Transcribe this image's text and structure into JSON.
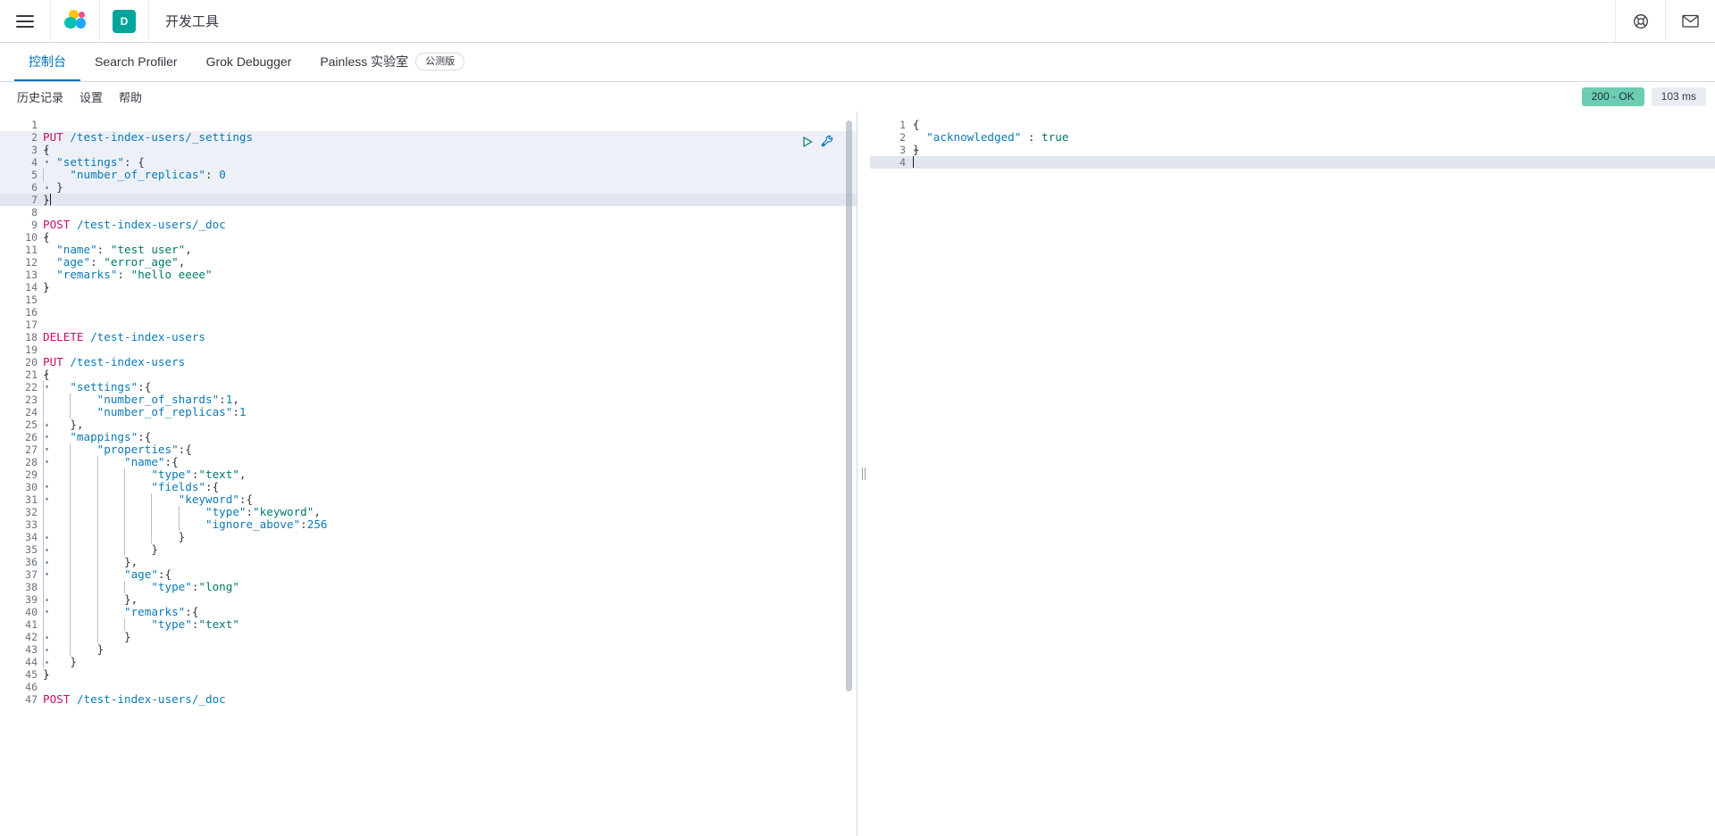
{
  "header": {
    "menu_label": "menu",
    "space_initial": "D",
    "app_title": "开发工具",
    "help_icon": "help-lifebuoy-icon",
    "mail_icon": "mail-icon"
  },
  "tabs": [
    {
      "label": "控制台",
      "active": true,
      "badge": null
    },
    {
      "label": "Search Profiler",
      "active": false,
      "badge": null
    },
    {
      "label": "Grok Debugger",
      "active": false,
      "badge": null
    },
    {
      "label": "Painless 实验室",
      "active": false,
      "badge": "公测版"
    }
  ],
  "subnav": {
    "items": [
      {
        "label": "历史记录"
      },
      {
        "label": "设置"
      },
      {
        "label": "帮助"
      }
    ],
    "status": "200 - OK",
    "duration": "103 ms",
    "status_color": "#6dccb1",
    "duration_bg": "#e9edf3"
  },
  "editor": {
    "play_icon": "play-request-icon",
    "wrench_icon": "wrench-open-docs-icon",
    "lines": [
      {
        "n": 1,
        "fold": "",
        "hl": false,
        "active": false,
        "text": ""
      },
      {
        "n": 2,
        "fold": "",
        "hl": true,
        "active": false,
        "text": "PUT /test-index-users/_settings"
      },
      {
        "n": 3,
        "fold": "▾",
        "hl": true,
        "active": false,
        "text": "{"
      },
      {
        "n": 4,
        "fold": "▾",
        "hl": true,
        "active": false,
        "text": "  \"settings\": {"
      },
      {
        "n": 5,
        "fold": "",
        "hl": true,
        "active": false,
        "text": "    \"number_of_replicas\": 0"
      },
      {
        "n": 6,
        "fold": "▴",
        "hl": true,
        "active": false,
        "text": "  }"
      },
      {
        "n": 7,
        "fold": "▴",
        "hl": true,
        "active": true,
        "text": "}"
      },
      {
        "n": 8,
        "fold": "",
        "hl": false,
        "active": false,
        "text": ""
      },
      {
        "n": 9,
        "fold": "",
        "hl": false,
        "active": false,
        "text": "POST /test-index-users/_doc"
      },
      {
        "n": 10,
        "fold": "▾",
        "hl": false,
        "active": false,
        "text": "{"
      },
      {
        "n": 11,
        "fold": "",
        "hl": false,
        "active": false,
        "text": "  \"name\": \"test user\","
      },
      {
        "n": 12,
        "fold": "",
        "hl": false,
        "active": false,
        "text": "  \"age\": \"error_age\","
      },
      {
        "n": 13,
        "fold": "",
        "hl": false,
        "active": false,
        "text": "  \"remarks\": \"hello eeee\""
      },
      {
        "n": 14,
        "fold": "▴",
        "hl": false,
        "active": false,
        "text": "}"
      },
      {
        "n": 15,
        "fold": "",
        "hl": false,
        "active": false,
        "text": ""
      },
      {
        "n": 16,
        "fold": "",
        "hl": false,
        "active": false,
        "text": ""
      },
      {
        "n": 17,
        "fold": "",
        "hl": false,
        "active": false,
        "text": ""
      },
      {
        "n": 18,
        "fold": "",
        "hl": false,
        "active": false,
        "text": "DELETE /test-index-users"
      },
      {
        "n": 19,
        "fold": "",
        "hl": false,
        "active": false,
        "text": ""
      },
      {
        "n": 20,
        "fold": "",
        "hl": false,
        "active": false,
        "text": "PUT /test-index-users"
      },
      {
        "n": 21,
        "fold": "▾",
        "hl": false,
        "active": false,
        "text": "{"
      },
      {
        "n": 22,
        "fold": "▾",
        "hl": false,
        "active": false,
        "text": "    \"settings\":{"
      },
      {
        "n": 23,
        "fold": "",
        "hl": false,
        "active": false,
        "text": "        \"number_of_shards\":1,"
      },
      {
        "n": 24,
        "fold": "",
        "hl": false,
        "active": false,
        "text": "        \"number_of_replicas\":1"
      },
      {
        "n": 25,
        "fold": "▴",
        "hl": false,
        "active": false,
        "text": "    },"
      },
      {
        "n": 26,
        "fold": "▾",
        "hl": false,
        "active": false,
        "text": "    \"mappings\":{"
      },
      {
        "n": 27,
        "fold": "▾",
        "hl": false,
        "active": false,
        "text": "        \"properties\":{"
      },
      {
        "n": 28,
        "fold": "▾",
        "hl": false,
        "active": false,
        "text": "            \"name\":{"
      },
      {
        "n": 29,
        "fold": "",
        "hl": false,
        "active": false,
        "text": "                \"type\":\"text\","
      },
      {
        "n": 30,
        "fold": "▾",
        "hl": false,
        "active": false,
        "text": "                \"fields\":{"
      },
      {
        "n": 31,
        "fold": "▾",
        "hl": false,
        "active": false,
        "text": "                    \"keyword\":{"
      },
      {
        "n": 32,
        "fold": "",
        "hl": false,
        "active": false,
        "text": "                        \"type\":\"keyword\","
      },
      {
        "n": 33,
        "fold": "",
        "hl": false,
        "active": false,
        "text": "                        \"ignore_above\":256"
      },
      {
        "n": 34,
        "fold": "▴",
        "hl": false,
        "active": false,
        "text": "                    }"
      },
      {
        "n": 35,
        "fold": "▴",
        "hl": false,
        "active": false,
        "text": "                }"
      },
      {
        "n": 36,
        "fold": "▴",
        "hl": false,
        "active": false,
        "text": "            },"
      },
      {
        "n": 37,
        "fold": "▾",
        "hl": false,
        "active": false,
        "text": "            \"age\":{"
      },
      {
        "n": 38,
        "fold": "",
        "hl": false,
        "active": false,
        "text": "                \"type\":\"long\""
      },
      {
        "n": 39,
        "fold": "▴",
        "hl": false,
        "active": false,
        "text": "            },"
      },
      {
        "n": 40,
        "fold": "▾",
        "hl": false,
        "active": false,
        "text": "            \"remarks\":{"
      },
      {
        "n": 41,
        "fold": "",
        "hl": false,
        "active": false,
        "text": "                \"type\":\"text\""
      },
      {
        "n": 42,
        "fold": "▴",
        "hl": false,
        "active": false,
        "text": "            }"
      },
      {
        "n": 43,
        "fold": "▴",
        "hl": false,
        "active": false,
        "text": "        }"
      },
      {
        "n": 44,
        "fold": "▴",
        "hl": false,
        "active": false,
        "text": "    }"
      },
      {
        "n": 45,
        "fold": "▴",
        "hl": false,
        "active": false,
        "text": "}"
      },
      {
        "n": 46,
        "fold": "",
        "hl": false,
        "active": false,
        "text": ""
      },
      {
        "n": 47,
        "fold": "",
        "hl": false,
        "active": false,
        "text": "POST /test-index-users/_doc"
      }
    ]
  },
  "response": {
    "lines": [
      {
        "n": 1,
        "fold": "▾",
        "active": false,
        "text": "{"
      },
      {
        "n": 2,
        "fold": "",
        "active": false,
        "text": "  \"acknowledged\" : true"
      },
      {
        "n": 3,
        "fold": "▴",
        "active": false,
        "text": "}"
      },
      {
        "n": 4,
        "fold": "",
        "active": true,
        "text": ""
      }
    ]
  }
}
